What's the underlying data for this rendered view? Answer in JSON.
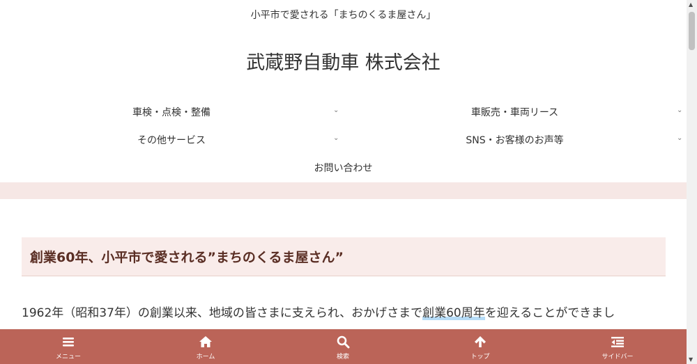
{
  "header": {
    "tagline": "小平市で愛される「まちのくるま屋さん」",
    "site_title": "武蔵野自動車 株式会社"
  },
  "nav": {
    "items": [
      {
        "label": "車検・点検・整備",
        "has_submenu": true
      },
      {
        "label": "車販売・車両リース",
        "has_submenu": true
      },
      {
        "label": "その他サービス",
        "has_submenu": true
      },
      {
        "label": "SNS・お客様のお声等",
        "has_submenu": true
      },
      {
        "label": "お問い合わせ",
        "has_submenu": false
      }
    ],
    "chevron": "⌄"
  },
  "article": {
    "heading": "創業60年、小平市で愛される”まちのくるま屋さん”",
    "paragraph_before": "1962年（昭和37年）の創業以来、地域の皆さまに支えられ、おかげさまで",
    "paragraph_highlight": "創業60周年",
    "paragraph_after": "を迎えることができまし"
  },
  "footer_menu": {
    "items": [
      {
        "label": "メニュー",
        "icon": "menu-icon"
      },
      {
        "label": "ホーム",
        "icon": "home-icon"
      },
      {
        "label": "検索",
        "icon": "search-icon"
      },
      {
        "label": "トップ",
        "icon": "arrow-up-icon"
      },
      {
        "label": "サイドバー",
        "icon": "sidebar-icon"
      }
    ]
  },
  "colors": {
    "footer_bg": "#bb6458",
    "band_bg": "#f6e7e5",
    "heading_bg": "#f9ecea",
    "heading_text": "#5a2e24",
    "highlight": "#b6dcf7"
  }
}
